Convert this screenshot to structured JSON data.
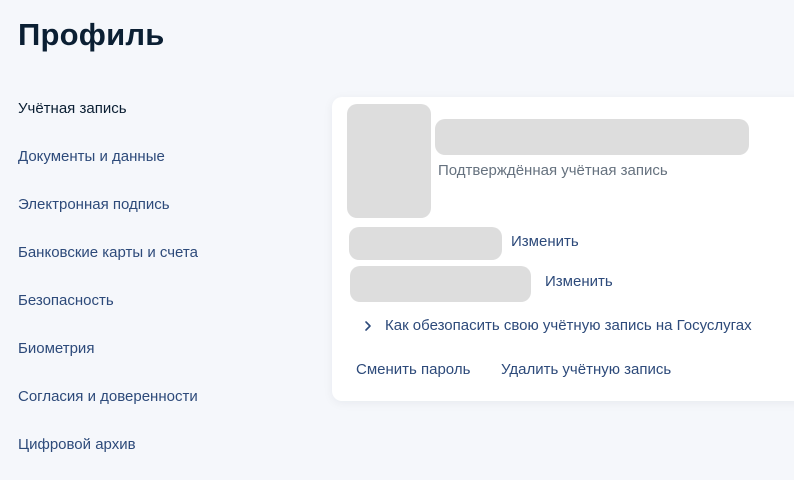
{
  "page": {
    "title": "Профиль"
  },
  "sidebar": {
    "items": [
      {
        "label": "Учётная запись"
      },
      {
        "label": "Документы и данные"
      },
      {
        "label": "Электронная подпись"
      },
      {
        "label": "Банковские карты и счета"
      },
      {
        "label": "Безопасность"
      },
      {
        "label": "Биометрия"
      },
      {
        "label": "Согласия и доверенности"
      },
      {
        "label": "Цифровой архив"
      }
    ]
  },
  "account_card": {
    "verified_status": "Подтверждённая учётная запись",
    "change_link_1": "Изменить",
    "change_link_2": "Изменить",
    "security_tip": "Как обезопасить свою учётную запись на Госуслугах",
    "change_password": "Сменить пароль",
    "delete_account": "Удалить учётную запись"
  },
  "icons": {
    "security_tip_icon": "chevron-right-icon"
  },
  "colors": {
    "background": "#f5f7fb",
    "card": "#ffffff",
    "link": "#2d4a7a",
    "heading": "#0b1f33",
    "muted": "#66727f",
    "skeleton": "#dddddd"
  }
}
